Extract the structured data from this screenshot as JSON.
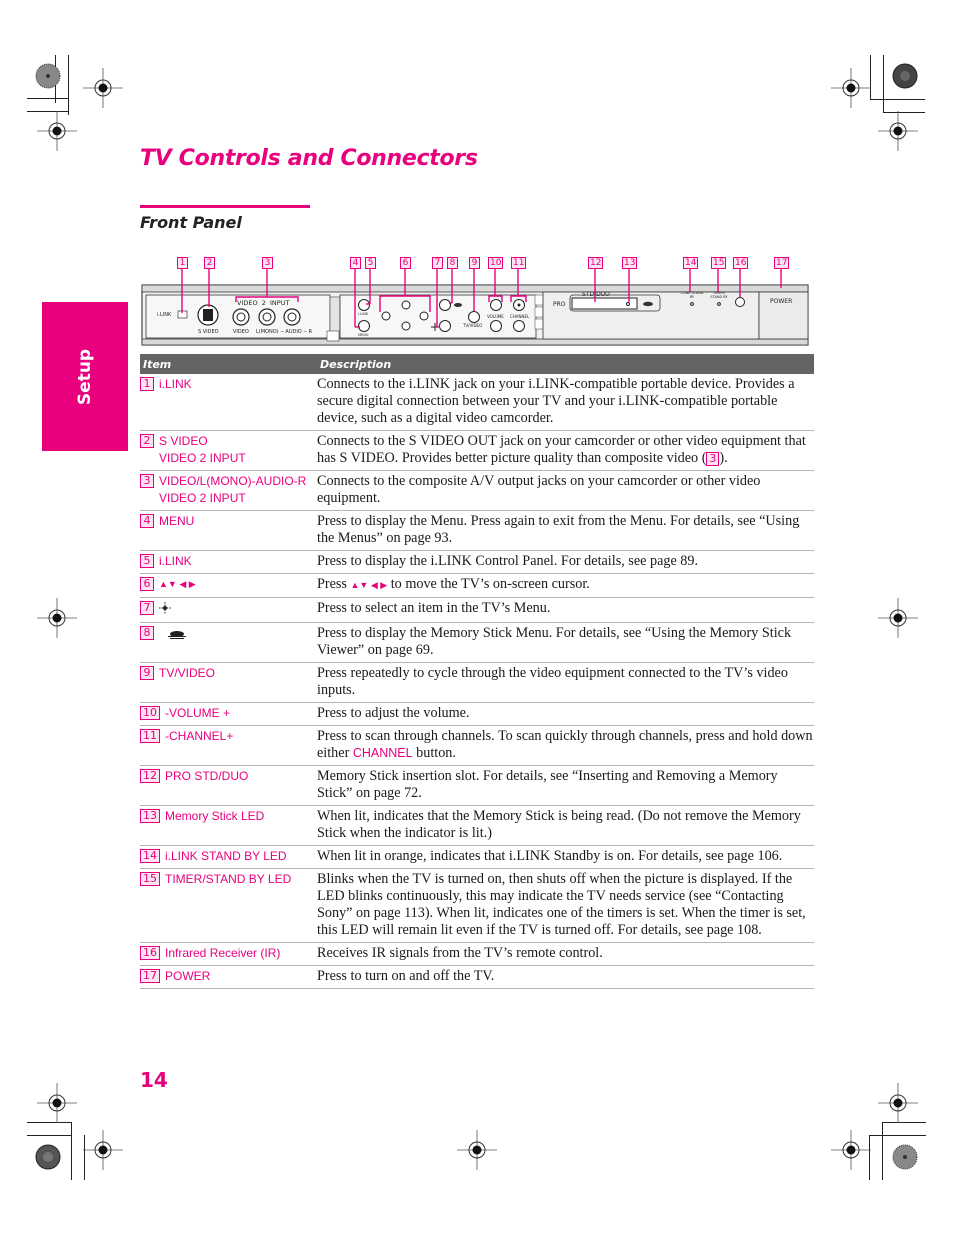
{
  "title": "TV Controls and Connectors",
  "section": "Front Panel",
  "side_tab": "Setup",
  "page_number": "14",
  "colors": {
    "accent": "#e8007f",
    "table_header": "#646464"
  },
  "diagram": {
    "callouts": [
      "1",
      "2",
      "3",
      "4",
      "5",
      "6",
      "7",
      "8",
      "9",
      "10",
      "11",
      "12",
      "13",
      "14",
      "15",
      "16",
      "17"
    ],
    "labels": {
      "ilink": "i.LINK",
      "s_video": "S VIDEO",
      "video2_input": "VIDEO  2  INPUT",
      "video": "VIDEO",
      "audio": "L(MONO) -- AUDIO -- R",
      "ilink_btn": "i.LINK",
      "menu": "MENU",
      "tv_video": "TV/VIDEO",
      "volume": "VOLUME",
      "channel": "CHANNEL",
      "std_duo": "STD/DUO",
      "pro": "PRO",
      "ilink_standby": "i.LINK STAND BY",
      "timer_standby": "TIMER/ STAND BY",
      "power": "POWER"
    }
  },
  "table": {
    "headers": {
      "item": "Item",
      "description": "Description"
    },
    "rows": [
      {
        "num": "1",
        "item": [
          "i.LINK"
        ],
        "desc": "Connects to the i.LINK jack on your i.LINK-compatible portable device. Provides a secure digital connection between your TV and your i.LINK-compatible portable device, such as a digital video camcorder."
      },
      {
        "num": "2",
        "item": [
          "S VIDEO",
          "VIDEO 2 INPUT"
        ],
        "desc_pre": "Connects to the S VIDEO OUT jack on your camcorder or other video equipment that has S VIDEO. Provides better picture quality than composite video (",
        "desc_ref": "3",
        "desc_post": ")."
      },
      {
        "num": "3",
        "item": [
          "VIDEO/L(MONO)-AUDIO-R",
          "VIDEO 2 INPUT"
        ],
        "desc": "Connects to the composite A/V output jacks on your camcorder or other video equipment."
      },
      {
        "num": "4",
        "item": [
          "MENU"
        ],
        "desc": "Press to display the Menu. Press again to exit from the Menu. For details, see “Using the Menus” on page 93."
      },
      {
        "num": "5",
        "item": [
          "i.LINK"
        ],
        "desc": "Press to display the i.LINK Control Panel. For details, see page 89."
      },
      {
        "num": "6",
        "item": [
          "▲▼ ◀ ▶"
        ],
        "desc_pre": "Press ",
        "desc_arrows": "▲▼ ◀ ▶",
        "desc_post": " to move the TV’s on-screen cursor."
      },
      {
        "num": "7",
        "item": [
          "select-icon"
        ],
        "desc": "Press to select an item in the TV’s Menu."
      },
      {
        "num": "8",
        "item": [
          "memory-stick-icon"
        ],
        "desc": "Press to display the Memory Stick Menu. For details, see “Using the Memory Stick Viewer” on page 69."
      },
      {
        "num": "9",
        "item": [
          "TV/VIDEO"
        ],
        "desc": "Press repeatedly to cycle through the video equipment connected to the TV’s video inputs."
      },
      {
        "num": "10",
        "item": [
          "-VOLUME +"
        ],
        "desc": "Press to adjust the volume."
      },
      {
        "num": "11",
        "item": [
          "-CHANNEL+"
        ],
        "desc_pre": "Press to scan through channels. To scan quickly through channels, press and hold down either ",
        "desc_pink": "CHANNEL",
        "desc_post": " button."
      },
      {
        "num": "12",
        "item": [
          "PRO STD/DUO"
        ],
        "desc": "Memory Stick insertion slot. For details, see “Inserting and Removing a Memory Stick” on page 72."
      },
      {
        "num": "13",
        "item": [
          "Memory Stick LED"
        ],
        "desc": "When lit, indicates that the Memory Stick is being read. (Do not remove the Memory Stick when the indicator is lit.)"
      },
      {
        "num": "14",
        "item": [
          "i.LINK STAND BY LED"
        ],
        "desc": "When lit in orange, indicates that i.LINK Standby is on. For details, see page 106."
      },
      {
        "num": "15",
        "item": [
          "TIMER/STAND BY LED"
        ],
        "desc": "Blinks when the TV is turned on, then shuts off when the picture is displayed. If the LED blinks continuously, this may indicate the TV needs service (see “Contacting Sony” on page 113). When lit, indicates one of the timers is set. When the timer is set, this LED will remain lit even if the TV is turned off. For details, see page 108."
      },
      {
        "num": "16",
        "item": [
          "Infrared Receiver (IR)"
        ],
        "desc": "Receives IR signals from the TV’s remote control."
      },
      {
        "num": "17",
        "item": [
          "POWER"
        ],
        "desc": "Press to turn on and off the TV."
      }
    ]
  }
}
